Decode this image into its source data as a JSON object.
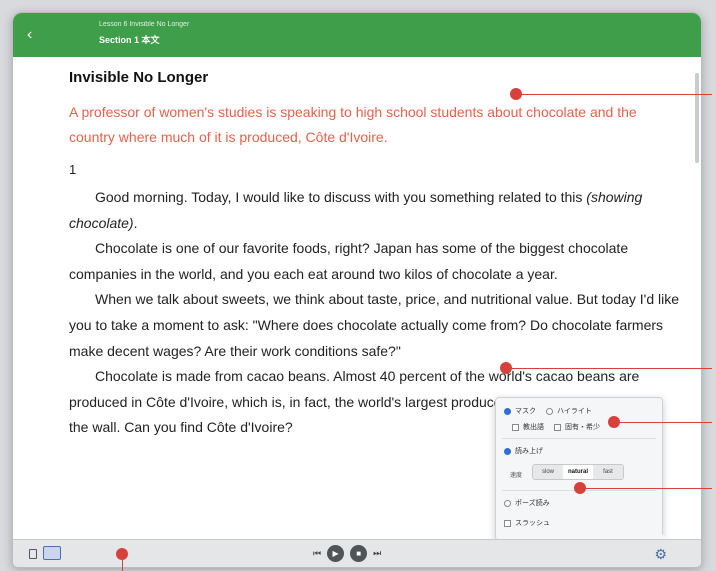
{
  "header": {
    "back_glyph": "‹",
    "crumb_small": "Lesson 6 Invisible No Longer",
    "crumb_main": "Section 1  本文"
  },
  "content": {
    "title": "Invisible No Longer",
    "intro": "A professor of women's studies is speaking to high school students about chocolate and the country where much of it is produced, Côte d'Ivoire.",
    "section_number": "1",
    "paragraphs": [
      {
        "text_before": "Good morning.   Today, I would like to discuss with you something related to this ",
        "emphasis": "(showing chocolate)",
        "text_after": "."
      },
      {
        "text": "Chocolate is one of our favorite foods, right?   Japan has some of the biggest chocolate companies in the world, and you each eat around two kilos of chocolate a year."
      },
      {
        "text": "When we talk about sweets, we think about taste, price, and nutritional value.   But today I'd like you to take a moment to ask: \"Where does chocolate actually come from?   Do chocolate farmers make decent wages?   Are their work conditions safe?\""
      },
      {
        "text": "Chocolate is made from cacao beans.   Almost 40 percent of the world's cacao beans are produced in Côte d'Ivoire, which is, in fact, the world's largest producer.   Now, look at the map on the wall.   Can you find Côte d'Ivoire?"
      }
    ]
  },
  "settings_popup": {
    "mask_label": "マスク",
    "highlight_label": "ハイライト",
    "check_a_label": "教出語",
    "check_b_label": "固有・希少",
    "read_aloud_label": "読み上げ",
    "speed_label": "速度",
    "speeds": [
      "slow",
      "natural",
      "fast"
    ],
    "speed_selected": "natural",
    "pause_label": "ポーズ読み",
    "slash_label": "スラッシュ"
  },
  "toolbar": {
    "page_icon": "single-page-icon",
    "spread_icon": "spread-view-icon",
    "prev_glyph": "⏮",
    "play_glyph": "▶",
    "stop_glyph": "■",
    "next_glyph": "⏭",
    "gear_glyph": "⚙"
  },
  "colors": {
    "header_green": "#3f9e4a",
    "intro_text": "#e2634b",
    "callout_red": "#d6413c",
    "toolbar_blue": "#4d6ea8"
  }
}
